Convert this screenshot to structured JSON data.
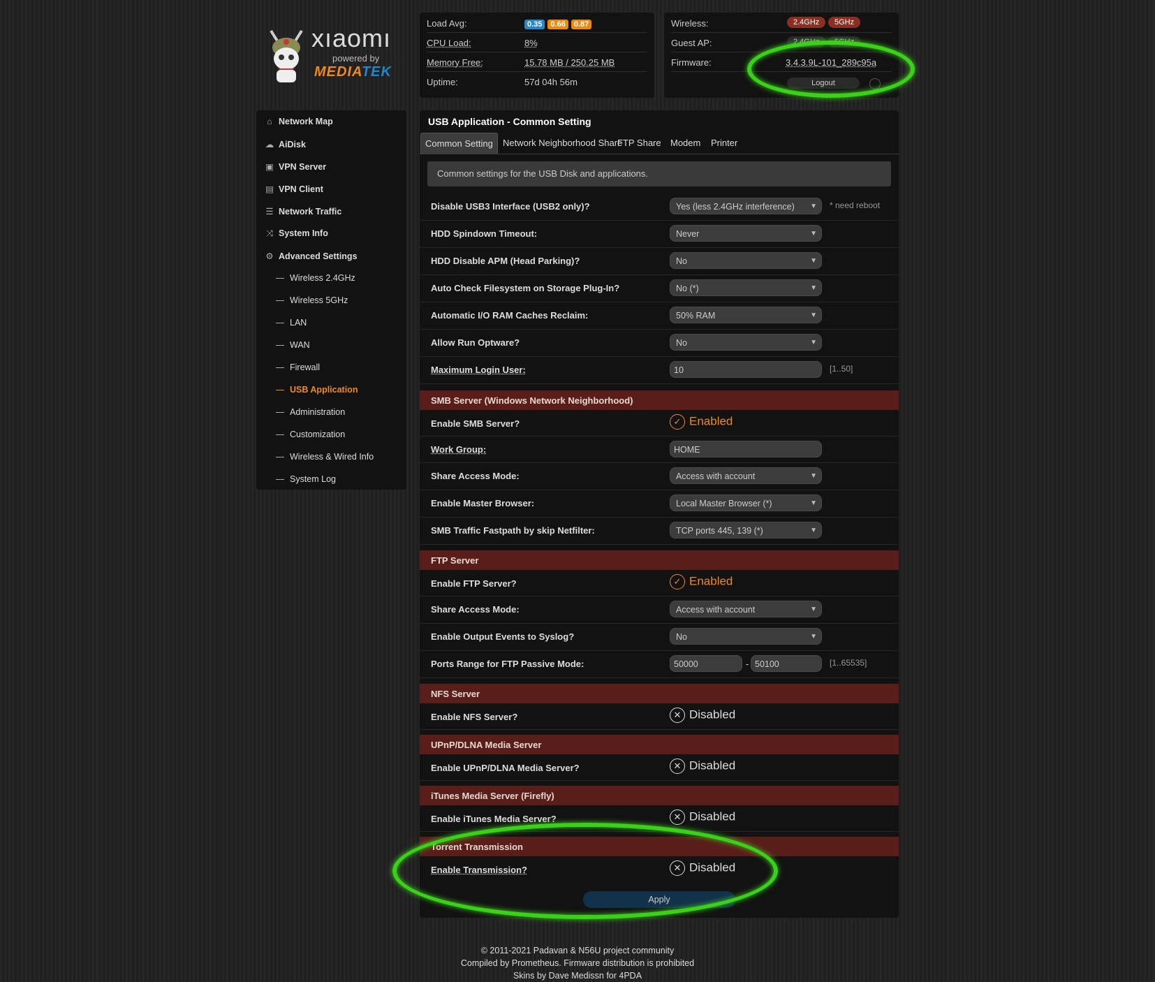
{
  "logo": {
    "brand": "xıaomı",
    "powered": "powered by",
    "mtk_a": "MEDIA",
    "mtk_b": "TEK"
  },
  "status": {
    "load_avg_label": "Load Avg:",
    "load_avg": [
      "0.35",
      "0.66",
      "0.87"
    ],
    "load_colors": [
      "#2a86c6",
      "#e88a14",
      "#e88a14"
    ],
    "cpu_label": "CPU Load:",
    "cpu": "8%",
    "mem_label": "Memory Free:",
    "mem": "15.78 MB / 250.25 MB",
    "uptime_label": "Uptime:",
    "uptime": "57d 04h 56m"
  },
  "system": {
    "wireless_label": "Wireless:",
    "guest_label": "Guest AP:",
    "firmware_label": "Firmware:",
    "band_24": "2.4GHz",
    "band_5": "5GHz",
    "firmware": "3.4.3.9L-101_289c95a",
    "logout": "Logout"
  },
  "sidebar": {
    "main": [
      {
        "label": "Network Map",
        "icon": "home-icon",
        "glyph": "⌂"
      },
      {
        "label": "AiDisk",
        "icon": "cloud-icon",
        "glyph": "☁"
      },
      {
        "label": "VPN Server",
        "icon": "server-icon",
        "glyph": "▣"
      },
      {
        "label": "VPN Client",
        "icon": "lock-icon",
        "glyph": "▤"
      },
      {
        "label": "Network Traffic",
        "icon": "list-icon",
        "glyph": "☰"
      },
      {
        "label": "System Info",
        "icon": "shuffle-icon",
        "glyph": "⤨"
      },
      {
        "label": "Advanced Settings",
        "icon": "gear-icon",
        "glyph": "⚙"
      }
    ],
    "sub": [
      "Wireless 2.4GHz",
      "Wireless 5GHz",
      "LAN",
      "WAN",
      "Firewall",
      "USB Application",
      "Administration",
      "Customization",
      "Wireless & Wired Info",
      "System Log"
    ]
  },
  "page": {
    "title": "USB Application - Common Setting",
    "tabs": [
      "Common Setting",
      "Network Neighborhood Share",
      "FTP Share",
      "Modem",
      "Printer"
    ],
    "note": "Common settings for the USB Disk and applications."
  },
  "common": {
    "usb3_label": "Disable USB3 Interface (USB2 only)?",
    "usb3_value": "Yes (less 2.4GHz interference)",
    "usb3_hint": "* need reboot",
    "spindown_label": "HDD Spindown Timeout:",
    "spindown_value": "Never",
    "apm_label": "HDD Disable APM (Head Parking)?",
    "apm_value": "No",
    "fsck_label": "Auto Check Filesystem on Storage Plug-In?",
    "fsck_value": "No (*)",
    "reclaim_label": "Automatic I/O RAM Caches Reclaim:",
    "reclaim_value": "50% RAM",
    "optware_label": "Allow Run Optware?",
    "optware_value": "No",
    "maxlogin_label": "Maximum Login User:",
    "maxlogin_value": "10",
    "maxlogin_hint": "[1..50]"
  },
  "smb": {
    "header": "SMB Server (Windows Network Neighborhood)",
    "enable_label": "Enable SMB Server?",
    "enable_value": "Enabled",
    "workgroup_label": "Work Group:",
    "workgroup_value": "HOME",
    "access_label": "Share Access Mode:",
    "access_value": "Access with account",
    "master_label": "Enable Master Browser:",
    "master_value": "Local Master Browser (*)",
    "fastpath_label": "SMB Traffic Fastpath by skip Netfilter:",
    "fastpath_value": "TCP ports 445, 139 (*)"
  },
  "ftp": {
    "header": "FTP Server",
    "enable_label": "Enable FTP Server?",
    "enable_value": "Enabled",
    "access_label": "Share Access Mode:",
    "access_value": "Access with account",
    "syslog_label": "Enable Output Events to Syslog?",
    "syslog_value": "No",
    "ports_label": "Ports Range for FTP Passive Mode:",
    "port_from": "50000",
    "port_sep": "-",
    "port_to": "50100",
    "ports_hint": "[1..65535]"
  },
  "nfs": {
    "header": "NFS Server",
    "enable_label": "Enable NFS Server?",
    "enable_value": "Disabled"
  },
  "dlna": {
    "header": "UPnP/DLNA Media Server",
    "enable_label": "Enable UPnP/DLNA Media Server?",
    "enable_value": "Disabled"
  },
  "itunes": {
    "header": "iTunes Media Server (Firefly)",
    "enable_label": "Enable iTunes Media Server?",
    "enable_value": "Disabled"
  },
  "torrent": {
    "header": "Torrent Transmission",
    "enable_label": "Enable Transmission?",
    "enable_value": "Disabled"
  },
  "apply": "Apply",
  "footer": {
    "line1": "© 2011-2021 Padavan & N56U project community",
    "line2": "Compiled by Prometheus. Firmware distribution is prohibited",
    "line3": "Skins by Dave Medissn for 4PDA"
  },
  "colors": {
    "accent": "#f08a1a",
    "section": "#5a1e1a",
    "highlight": "#3bd11a"
  }
}
